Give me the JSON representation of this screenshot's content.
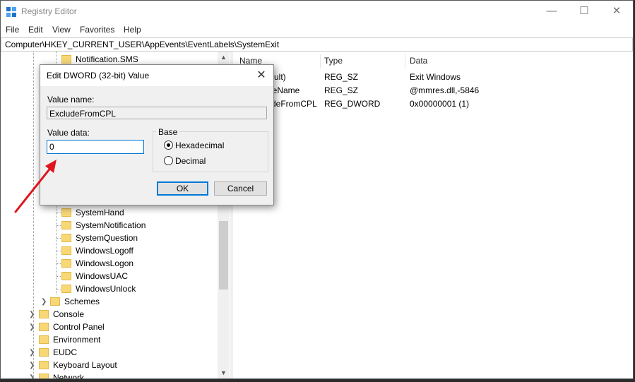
{
  "window": {
    "title": "Registry Editor",
    "controls": {
      "minimize": "—",
      "maximize": "☐",
      "close": "✕"
    }
  },
  "menu": [
    "File",
    "Edit",
    "View",
    "Favorites",
    "Help"
  ],
  "address": "Computer\\HKEY_CURRENT_USER\\AppEvents\\EventLabels\\SystemExit",
  "tree": {
    "top_item": "Notification.SMS",
    "children": [
      "SystemHand",
      "SystemNotification",
      "SystemQuestion",
      "WindowsLogoff",
      "WindowsLogon",
      "WindowsUAC",
      "WindowsUnlock"
    ],
    "schemes": "Schemes",
    "root_items": [
      "Console",
      "Control Panel",
      "Environment",
      "EUDC",
      "Keyboard Layout",
      "Network"
    ]
  },
  "list": {
    "headers": {
      "name": "Name",
      "type": "Type",
      "data": "Data"
    },
    "rows": [
      {
        "name": "ult)",
        "type": "REG_SZ",
        "data": "Exit Windows"
      },
      {
        "name": "leName",
        "type": "REG_SZ",
        "data": "@mmres.dll,-5846"
      },
      {
        "name": "deFromCPL",
        "type": "REG_DWORD",
        "data": "0x00000001 (1)"
      }
    ]
  },
  "dialog": {
    "title": "Edit DWORD (32-bit) Value",
    "close": "✕",
    "value_name_label": "Value name:",
    "value_name": "ExcludeFromCPL",
    "value_data_label": "Value data:",
    "value_data": "0",
    "base_label": "Base",
    "hex_label": "Hexadecimal",
    "dec_label": "Decimal",
    "selected_base": "Hexadecimal",
    "ok": "OK",
    "cancel": "Cancel"
  },
  "colors": {
    "accent": "#0078d7",
    "annotation_arrow": "#e0141e",
    "folder": "#f8d775"
  }
}
